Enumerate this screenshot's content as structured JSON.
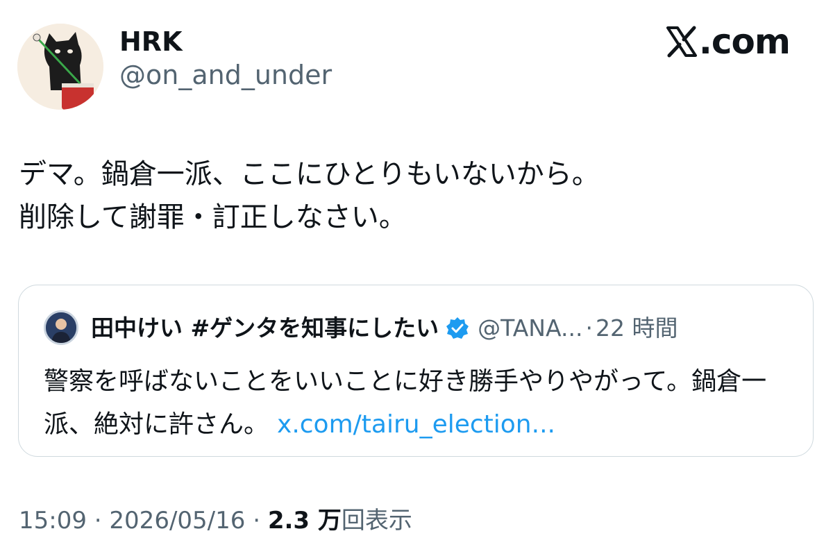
{
  "author": {
    "display_name": "HRK",
    "handle": "@on_and_under",
    "avatar_icon": "cat-drummer-avatar"
  },
  "brand": {
    "label": ".com",
    "icon": "x-logo-icon"
  },
  "tweet": {
    "text": "デマ。鍋倉一派、ここにひとりもいないから。\n削除して謝罪・訂正しなさい。"
  },
  "quote": {
    "display_name": "田中けい #ゲンタを知事にしたい",
    "verified_icon": "verified-badge-icon",
    "handle": "@TANA...",
    "separator": "·",
    "time": "22 時間",
    "text": "警察を呼ばないことをいいことに好き勝手やりやがって。鍋倉一派、絶対に許さん。",
    "link": "x.com/tairu_election..."
  },
  "meta": {
    "time": "15:09",
    "separator": "·",
    "date": "2026/05/16",
    "views_count": "2.3 万",
    "views_label": "回表示"
  },
  "colors": {
    "text": "#0f1419",
    "secondary": "#536471",
    "link": "#1d9bf0",
    "border": "#cfd9de",
    "verified": "#1d9bf0"
  }
}
